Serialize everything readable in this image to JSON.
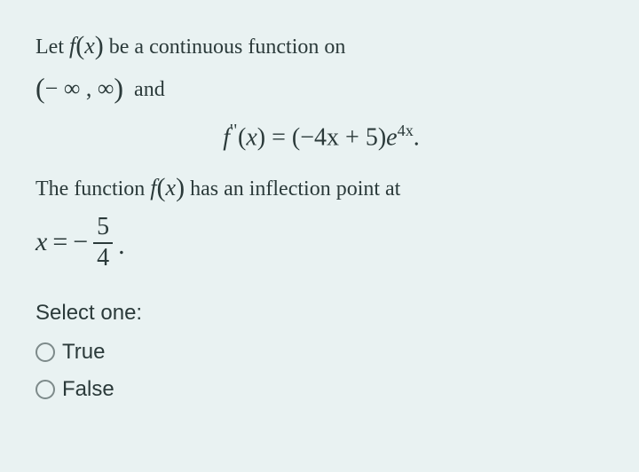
{
  "question": {
    "line1_pre": "Let ",
    "line1_fx": "f",
    "line1_paren_open": "(",
    "line1_var": "x",
    "line1_paren_close": ")",
    "line1_post": " be a continuous function on",
    "line2_interval_open": "(",
    "line2_interval_body": "− ∞ , ∞",
    "line2_interval_close": ")",
    "line2_post": "  and",
    "equation": {
      "lhs_f": "f",
      "lhs_primes": "''",
      "lhs_open": "(",
      "lhs_var": "x",
      "lhs_close": ")",
      "eq": " = ",
      "rhs_open": "(",
      "rhs_body": "−4x + 5",
      "rhs_close": ")",
      "rhs_e": "e",
      "rhs_exp": "4x",
      "dot": "."
    },
    "line4_pre": "The function ",
    "line4_fx_f": "f",
    "line4_fx_open": "(",
    "line4_fx_var": "x",
    "line4_fx_close": ")",
    "line4_post": " has an inflection point at",
    "claim": {
      "x": "x",
      "eq": " = ",
      "neg": "− ",
      "num": "5",
      "den": "4",
      "dot": "."
    }
  },
  "prompt": "Select one:",
  "options": {
    "true": "True",
    "false": "False"
  }
}
